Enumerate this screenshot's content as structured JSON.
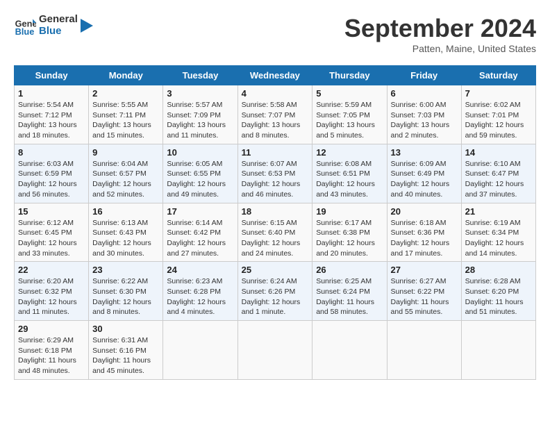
{
  "header": {
    "logo_line1": "General",
    "logo_line2": "Blue",
    "month_title": "September 2024",
    "location": "Patten, Maine, United States"
  },
  "weekdays": [
    "Sunday",
    "Monday",
    "Tuesday",
    "Wednesday",
    "Thursday",
    "Friday",
    "Saturday"
  ],
  "weeks": [
    [
      {
        "day": "1",
        "sunrise": "Sunrise: 5:54 AM",
        "sunset": "Sunset: 7:12 PM",
        "daylight": "Daylight: 13 hours and 18 minutes."
      },
      {
        "day": "2",
        "sunrise": "Sunrise: 5:55 AM",
        "sunset": "Sunset: 7:11 PM",
        "daylight": "Daylight: 13 hours and 15 minutes."
      },
      {
        "day": "3",
        "sunrise": "Sunrise: 5:57 AM",
        "sunset": "Sunset: 7:09 PM",
        "daylight": "Daylight: 13 hours and 11 minutes."
      },
      {
        "day": "4",
        "sunrise": "Sunrise: 5:58 AM",
        "sunset": "Sunset: 7:07 PM",
        "daylight": "Daylight: 13 hours and 8 minutes."
      },
      {
        "day": "5",
        "sunrise": "Sunrise: 5:59 AM",
        "sunset": "Sunset: 7:05 PM",
        "daylight": "Daylight: 13 hours and 5 minutes."
      },
      {
        "day": "6",
        "sunrise": "Sunrise: 6:00 AM",
        "sunset": "Sunset: 7:03 PM",
        "daylight": "Daylight: 13 hours and 2 minutes."
      },
      {
        "day": "7",
        "sunrise": "Sunrise: 6:02 AM",
        "sunset": "Sunset: 7:01 PM",
        "daylight": "Daylight: 12 hours and 59 minutes."
      }
    ],
    [
      {
        "day": "8",
        "sunrise": "Sunrise: 6:03 AM",
        "sunset": "Sunset: 6:59 PM",
        "daylight": "Daylight: 12 hours and 56 minutes."
      },
      {
        "day": "9",
        "sunrise": "Sunrise: 6:04 AM",
        "sunset": "Sunset: 6:57 PM",
        "daylight": "Daylight: 12 hours and 52 minutes."
      },
      {
        "day": "10",
        "sunrise": "Sunrise: 6:05 AM",
        "sunset": "Sunset: 6:55 PM",
        "daylight": "Daylight: 12 hours and 49 minutes."
      },
      {
        "day": "11",
        "sunrise": "Sunrise: 6:07 AM",
        "sunset": "Sunset: 6:53 PM",
        "daylight": "Daylight: 12 hours and 46 minutes."
      },
      {
        "day": "12",
        "sunrise": "Sunrise: 6:08 AM",
        "sunset": "Sunset: 6:51 PM",
        "daylight": "Daylight: 12 hours and 43 minutes."
      },
      {
        "day": "13",
        "sunrise": "Sunrise: 6:09 AM",
        "sunset": "Sunset: 6:49 PM",
        "daylight": "Daylight: 12 hours and 40 minutes."
      },
      {
        "day": "14",
        "sunrise": "Sunrise: 6:10 AM",
        "sunset": "Sunset: 6:47 PM",
        "daylight": "Daylight: 12 hours and 37 minutes."
      }
    ],
    [
      {
        "day": "15",
        "sunrise": "Sunrise: 6:12 AM",
        "sunset": "Sunset: 6:45 PM",
        "daylight": "Daylight: 12 hours and 33 minutes."
      },
      {
        "day": "16",
        "sunrise": "Sunrise: 6:13 AM",
        "sunset": "Sunset: 6:43 PM",
        "daylight": "Daylight: 12 hours and 30 minutes."
      },
      {
        "day": "17",
        "sunrise": "Sunrise: 6:14 AM",
        "sunset": "Sunset: 6:42 PM",
        "daylight": "Daylight: 12 hours and 27 minutes."
      },
      {
        "day": "18",
        "sunrise": "Sunrise: 6:15 AM",
        "sunset": "Sunset: 6:40 PM",
        "daylight": "Daylight: 12 hours and 24 minutes."
      },
      {
        "day": "19",
        "sunrise": "Sunrise: 6:17 AM",
        "sunset": "Sunset: 6:38 PM",
        "daylight": "Daylight: 12 hours and 20 minutes."
      },
      {
        "day": "20",
        "sunrise": "Sunrise: 6:18 AM",
        "sunset": "Sunset: 6:36 PM",
        "daylight": "Daylight: 12 hours and 17 minutes."
      },
      {
        "day": "21",
        "sunrise": "Sunrise: 6:19 AM",
        "sunset": "Sunset: 6:34 PM",
        "daylight": "Daylight: 12 hours and 14 minutes."
      }
    ],
    [
      {
        "day": "22",
        "sunrise": "Sunrise: 6:20 AM",
        "sunset": "Sunset: 6:32 PM",
        "daylight": "Daylight: 12 hours and 11 minutes."
      },
      {
        "day": "23",
        "sunrise": "Sunrise: 6:22 AM",
        "sunset": "Sunset: 6:30 PM",
        "daylight": "Daylight: 12 hours and 8 minutes."
      },
      {
        "day": "24",
        "sunrise": "Sunrise: 6:23 AM",
        "sunset": "Sunset: 6:28 PM",
        "daylight": "Daylight: 12 hours and 4 minutes."
      },
      {
        "day": "25",
        "sunrise": "Sunrise: 6:24 AM",
        "sunset": "Sunset: 6:26 PM",
        "daylight": "Daylight: 12 hours and 1 minute."
      },
      {
        "day": "26",
        "sunrise": "Sunrise: 6:25 AM",
        "sunset": "Sunset: 6:24 PM",
        "daylight": "Daylight: 11 hours and 58 minutes."
      },
      {
        "day": "27",
        "sunrise": "Sunrise: 6:27 AM",
        "sunset": "Sunset: 6:22 PM",
        "daylight": "Daylight: 11 hours and 55 minutes."
      },
      {
        "day": "28",
        "sunrise": "Sunrise: 6:28 AM",
        "sunset": "Sunset: 6:20 PM",
        "daylight": "Daylight: 11 hours and 51 minutes."
      }
    ],
    [
      {
        "day": "29",
        "sunrise": "Sunrise: 6:29 AM",
        "sunset": "Sunset: 6:18 PM",
        "daylight": "Daylight: 11 hours and 48 minutes."
      },
      {
        "day": "30",
        "sunrise": "Sunrise: 6:31 AM",
        "sunset": "Sunset: 6:16 PM",
        "daylight": "Daylight: 11 hours and 45 minutes."
      },
      null,
      null,
      null,
      null,
      null
    ]
  ]
}
